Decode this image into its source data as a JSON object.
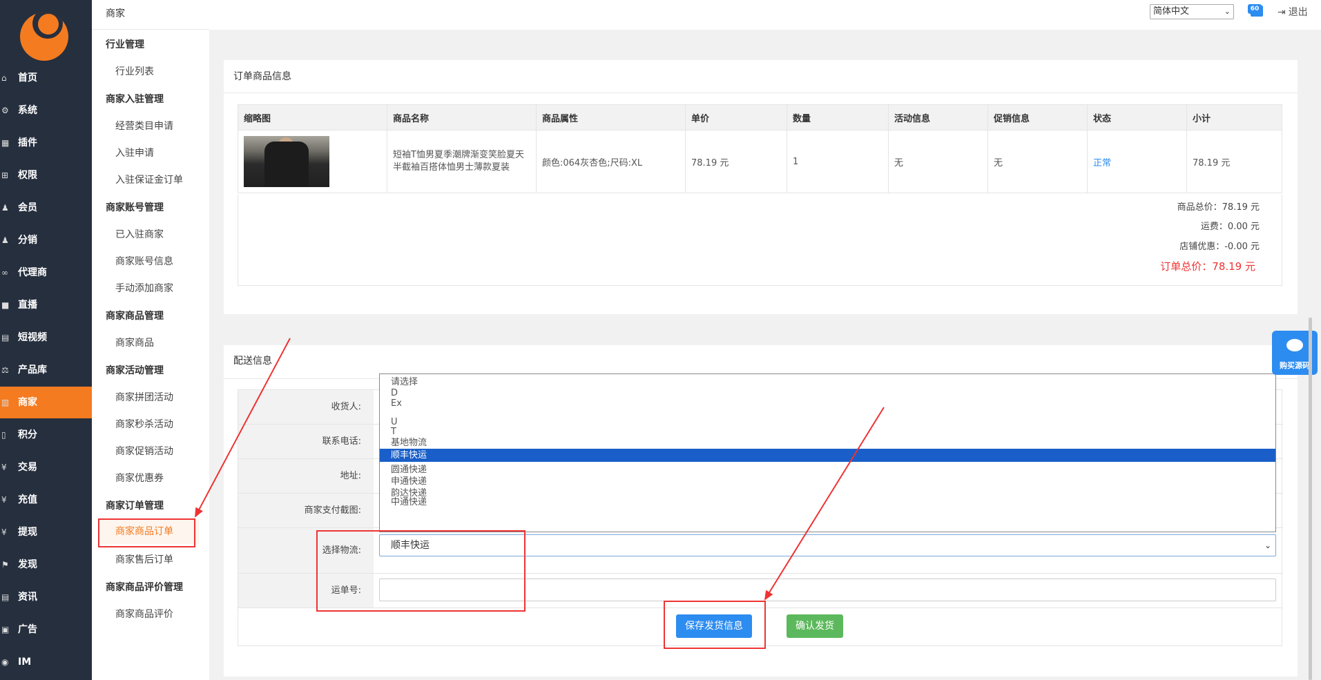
{
  "left_nav": [
    {
      "label": "首页",
      "icon": "home-icon",
      "glyph": "⌂"
    },
    {
      "label": "系统",
      "icon": "gear-icon",
      "glyph": "⚙"
    },
    {
      "label": "插件",
      "icon": "plugin-icon",
      "glyph": "▦"
    },
    {
      "label": "权限",
      "icon": "sitemap-icon",
      "glyph": "⊞"
    },
    {
      "label": "会员",
      "icon": "users-icon",
      "glyph": "♟"
    },
    {
      "label": "分销",
      "icon": "users-icon",
      "glyph": "♟"
    },
    {
      "label": "代理商",
      "icon": "link-icon",
      "glyph": "∞"
    },
    {
      "label": "直播",
      "icon": "video-icon",
      "glyph": "■"
    },
    {
      "label": "短视频",
      "icon": "film-icon",
      "glyph": "▤"
    },
    {
      "label": "产品库",
      "icon": "scale-icon",
      "glyph": "⚖"
    },
    {
      "label": "商家",
      "icon": "bank-icon",
      "glyph": "▥"
    },
    {
      "label": "积分",
      "icon": "file-icon",
      "glyph": "▯"
    },
    {
      "label": "交易",
      "icon": "currency-icon",
      "glyph": "¥"
    },
    {
      "label": "充值",
      "icon": "yen-icon",
      "glyph": "¥"
    },
    {
      "label": "提现",
      "icon": "yen-icon",
      "glyph": "¥"
    },
    {
      "label": "发现",
      "icon": "flag-icon",
      "glyph": "⚑"
    },
    {
      "label": "资讯",
      "icon": "news-icon",
      "glyph": "▤"
    },
    {
      "label": "广告",
      "icon": "image-icon",
      "glyph": "▣"
    },
    {
      "label": "IM",
      "icon": "chat-icon",
      "glyph": "◉"
    }
  ],
  "sub_nav": {
    "breadcrumb": "商家",
    "groups": [
      {
        "title": "行业管理",
        "items": [
          "行业列表"
        ]
      },
      {
        "title": "商家入驻管理",
        "items": [
          "经营类目申请",
          "入驻申请",
          "入驻保证金订单"
        ]
      },
      {
        "title": "商家账号管理",
        "items": [
          "已入驻商家",
          "商家账号信息",
          "手动添加商家"
        ]
      },
      {
        "title": "商家商品管理",
        "items": [
          "商家商品"
        ]
      },
      {
        "title": "商家活动管理",
        "items": [
          "商家拼团活动",
          "商家秒杀活动",
          "商家促销活动",
          "商家优惠券"
        ]
      },
      {
        "title": "商家订单管理",
        "items": [
          "商家商品订单",
          "商家售后订单"
        ]
      },
      {
        "title": "商家商品评价管理",
        "items": [
          "商家商品评价"
        ]
      }
    ]
  },
  "topbar": {
    "language": "简体中文",
    "badge": "60",
    "logout": "退出"
  },
  "order_panel": {
    "title": "订单商品信息",
    "columns": [
      "缩略图",
      "商品名称",
      "商品属性",
      "单价",
      "数量",
      "活动信息",
      "促销信息",
      "状态",
      "小计"
    ],
    "row": {
      "name": "短袖T恤男夏季潮牌渐变笑脸夏天半截袖百搭体恤男士薄款夏装",
      "attrs": "颜色:064灰杏色;尺码:XL",
      "price": "78.19 元",
      "qty": "1",
      "activity": "无",
      "promo": "无",
      "status": "正常",
      "subtotal": "78.19 元"
    },
    "totals": {
      "goods": "商品总价：78.19 元",
      "shipping": "运费：0.00 元",
      "discount": "店铺优惠：-0.00 元",
      "grand": "订单总价：78.19 元"
    }
  },
  "delivery_panel": {
    "title": "配送信息",
    "labels": {
      "receiver": "收货人:",
      "phone": "联系电话:",
      "address": "地址:",
      "pay_screenshot": "商家支付截图:",
      "logistics": "选择物流:",
      "waybill": "运单号:"
    },
    "logistics_selected": "顺丰快运",
    "options": [
      "请选择",
      "D",
      "Ex",
      "",
      "U",
      "T",
      "基地物流",
      "顺丰快运",
      "圆通快递",
      "申通快递",
      "韵达快递",
      "中通快递"
    ],
    "save_btn": "保存发货信息",
    "ship_btn": "确认发货"
  },
  "chat_widget": {
    "label": "购买源码"
  },
  "colors": {
    "accent": "#f47b20",
    "primary": "#2d8cf0",
    "success": "#5cb85c",
    "highlight": "#e33333",
    "sidebar": "#262f3e"
  }
}
